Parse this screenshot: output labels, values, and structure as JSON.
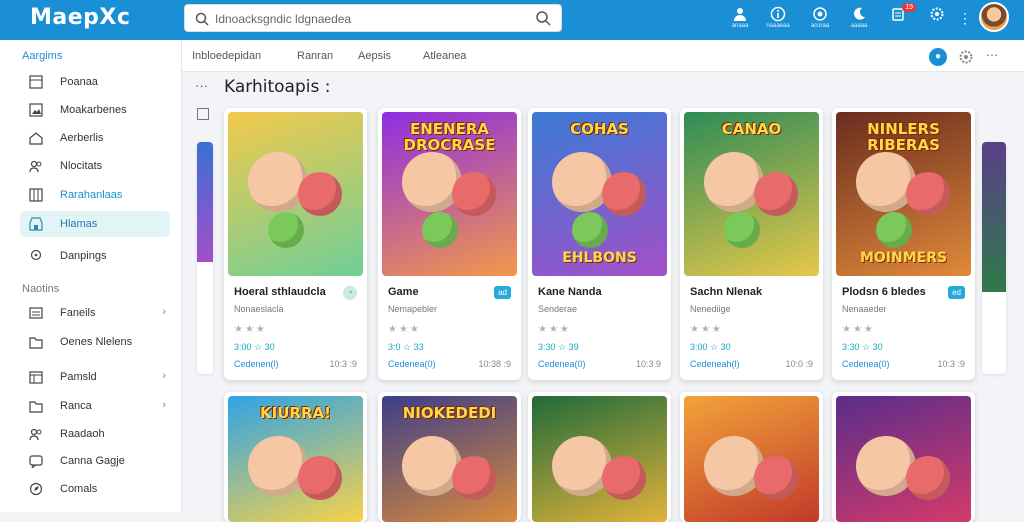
{
  "app": {
    "logo": "MaepXc"
  },
  "search": {
    "value": "Idnoacksgndic ldgnaedea"
  },
  "header_icons": [
    {
      "name": "profile-icon",
      "caption": "anaaa"
    },
    {
      "name": "info-icon",
      "caption": "naaaeaa"
    },
    {
      "name": "support-icon",
      "caption": "acoraa"
    },
    {
      "name": "moon-icon",
      "caption": "aaaaa"
    },
    {
      "name": "notifications-icon",
      "caption": "",
      "badge": "19"
    },
    {
      "name": "settings-icon",
      "caption": ""
    }
  ],
  "sidebar": {
    "section1": "Aargims",
    "items1": [
      {
        "label": "Poanaa",
        "icon": "library-icon"
      },
      {
        "label": "Moakarbenes",
        "icon": "image-icon"
      },
      {
        "label": "Aerberlis",
        "icon": "home-icon"
      },
      {
        "label": "Nlocitats",
        "icon": "users-icon"
      },
      {
        "label": "Rarahanlaas",
        "icon": "grid-icon",
        "highlight": true
      },
      {
        "label": "Hlamas",
        "icon": "store-icon",
        "active": true
      },
      {
        "label": "Danpings",
        "icon": "location-icon"
      }
    ],
    "section2": "Naotins",
    "items2": [
      {
        "label": "Faneils",
        "icon": "list-icon",
        "chevron": true
      },
      {
        "label": "Oenes Nlelens",
        "icon": "folder-icon"
      },
      {
        "label": "Pamsld",
        "icon": "calendar-icon",
        "chevron": true
      },
      {
        "label": "Ranca",
        "icon": "folder-icon",
        "chevron": true
      },
      {
        "label": "Raadaoh",
        "icon": "users-icon"
      },
      {
        "label": "Canna Gagje",
        "icon": "chat-icon"
      },
      {
        "label": "Comals",
        "icon": "compass-icon"
      }
    ]
  },
  "tabs": [
    "Inbloedepidan",
    "Ranran",
    "Aepsis",
    "Atleanea"
  ],
  "section_title": "Karhitoapis :",
  "cards_row1": [
    {
      "name": "Hoeral sthlaudcla",
      "sub": "Nonaeslacla",
      "price": "3:00 ☆ 30",
      "link": "Cedenen(l)",
      "meta": "10:3 :9",
      "tag": "",
      "banner": "",
      "banner2": "",
      "colors": [
        "#f2c94c",
        "#6fcf97"
      ]
    },
    {
      "name": "Game",
      "sub": "Nemapebler",
      "price": "3:0 ☆ 33",
      "link": "Cedenea(0)",
      "meta": "10:38 :9",
      "tag": "ad",
      "banner": "ENENERA DROCRASE",
      "banner2": "",
      "colors": [
        "#8e2de2",
        "#f2994a"
      ]
    },
    {
      "name": "Kane Nanda",
      "sub": "Senderae",
      "price": "3:30 ☆ 39",
      "link": "Cedenea(0)",
      "meta": "10:3 9",
      "tag": "",
      "banner": "COHAS",
      "banner2": "EHLBONS",
      "colors": [
        "#3a7bd5",
        "#a44fc8"
      ]
    },
    {
      "name": "Sachn Nlenak",
      "sub": "Nenediige",
      "price": "3:00 ☆ 30",
      "link": "Cedeneah(l)",
      "meta": "10:0 :9",
      "tag": "",
      "banner": "CANAO",
      "banner2": "",
      "colors": [
        "#2e8b57",
        "#e6c84a"
      ]
    },
    {
      "name": "Plodsn 6 bledes",
      "sub": "Nenaaeder",
      "price": "3:30 ☆ 30",
      "link": "Cedenea(0)",
      "meta": "10:3 :9",
      "tag": "ed",
      "banner": "NINLERS RIBERAS",
      "banner2": "MOINMERS",
      "colors": [
        "#6a2c1f",
        "#e0893a"
      ]
    }
  ],
  "cards_row2": [
    {
      "banner": "KIURRA!",
      "colors": [
        "#2fa3e6",
        "#f7d24a"
      ]
    },
    {
      "banner": "NIOKEDEDI",
      "colors": [
        "#3b3f8a",
        "#d98a3a"
      ]
    },
    {
      "banner": "",
      "colors": [
        "#1f6b3a",
        "#e2b23a"
      ]
    },
    {
      "banner": "",
      "colors": [
        "#f2a33a",
        "#c23a2a"
      ]
    },
    {
      "banner": "",
      "colors": [
        "#5a2d8a",
        "#d43a6a"
      ]
    }
  ]
}
